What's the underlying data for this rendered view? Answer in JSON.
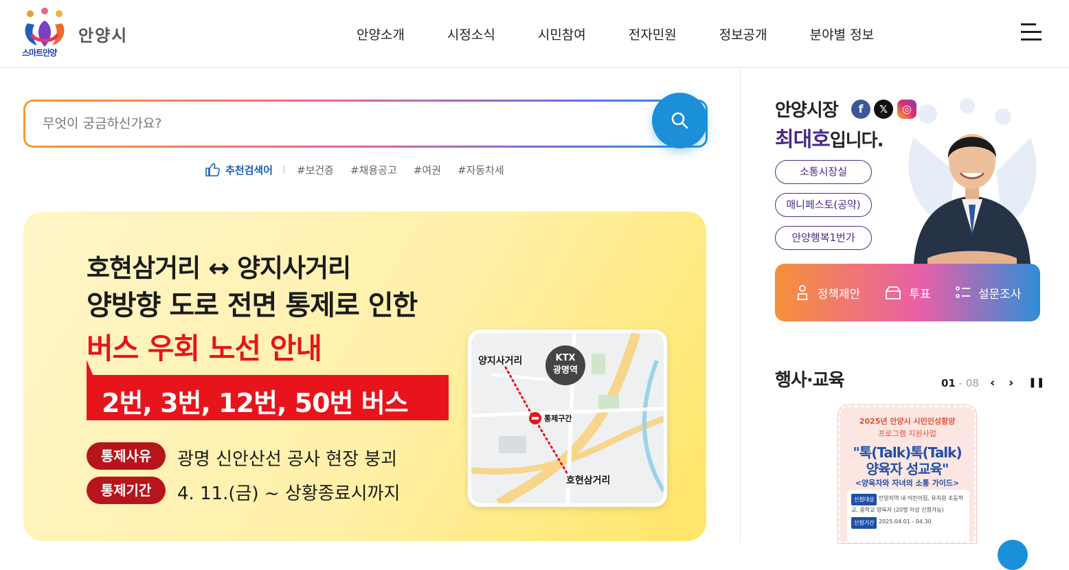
{
  "header": {
    "logo_caption": "스마트안양",
    "city_name": "안양시",
    "nav": [
      "안양소개",
      "시정소식",
      "시민참여",
      "전자민원",
      "정보공개",
      "분야별 정보"
    ]
  },
  "search": {
    "placeholder": "무엇이 궁금하신가요?",
    "recommend_label": "추천검색어",
    "tags": [
      "#보건증",
      "#채용공고",
      "#여권",
      "#자동차세"
    ]
  },
  "banner": {
    "line1": "호현삼거리 ↔ 양지사거리",
    "line2": "양방향 도로 전면 통제로 인한",
    "line3": "버스 우회 노선 안내",
    "bus_routes": "2번, 3번, 12번, 50번 버스",
    "reason_label": "통제사유",
    "reason": "광명 신안산선 공사 현장 붕괴",
    "period_label": "통제기간",
    "period": "4. 11.(금) ~ 상황종료시까지",
    "map": {
      "label_west": "양지사거리",
      "ktx_line1": "KTX",
      "ktx_line2": "광명역",
      "blocked_label": "통제구간",
      "label_south": "호현삼거리"
    }
  },
  "mayor": {
    "title": "안양시장",
    "name": "최대호",
    "name_suffix": "입니다.",
    "sns": {
      "facebook": "f",
      "x": "𝕏",
      "instagram": "◎"
    },
    "buttons": [
      "소통시장실",
      "매니페스토(공약)",
      "안양행복1번가"
    ]
  },
  "participation": [
    {
      "label": "정책제안",
      "icon": "person-podium-icon"
    },
    {
      "label": "투표",
      "icon": "ballot-box-icon"
    },
    {
      "label": "설문조사",
      "icon": "checklist-icon"
    }
  ],
  "events": {
    "title": "행사·교육",
    "current": "01",
    "separator": " - ",
    "total": "08",
    "poster": {
      "t1": "2025년 안양시 시민인성함양",
      "t2": "프로그램 지원사업",
      "t3": "\"톡(Talk)톡(Talk)",
      "t4": "양육자 성교육\"",
      "t5": "<양육자와 자녀의 소통 가이드>",
      "row1_tag": "신청대상",
      "row1_text": "안양지역 내 어린이집, 유치원 초등학교, 중학교 양육자 (20명 이상 신청가능)",
      "row2_tag": "신청기간",
      "row2_text": "2025.04.01 - 04.30"
    }
  },
  "colors": {
    "accent_blue": "#1c8fd9",
    "banner_red": "#e8141b",
    "mayor_purple": "#4a2a87"
  }
}
